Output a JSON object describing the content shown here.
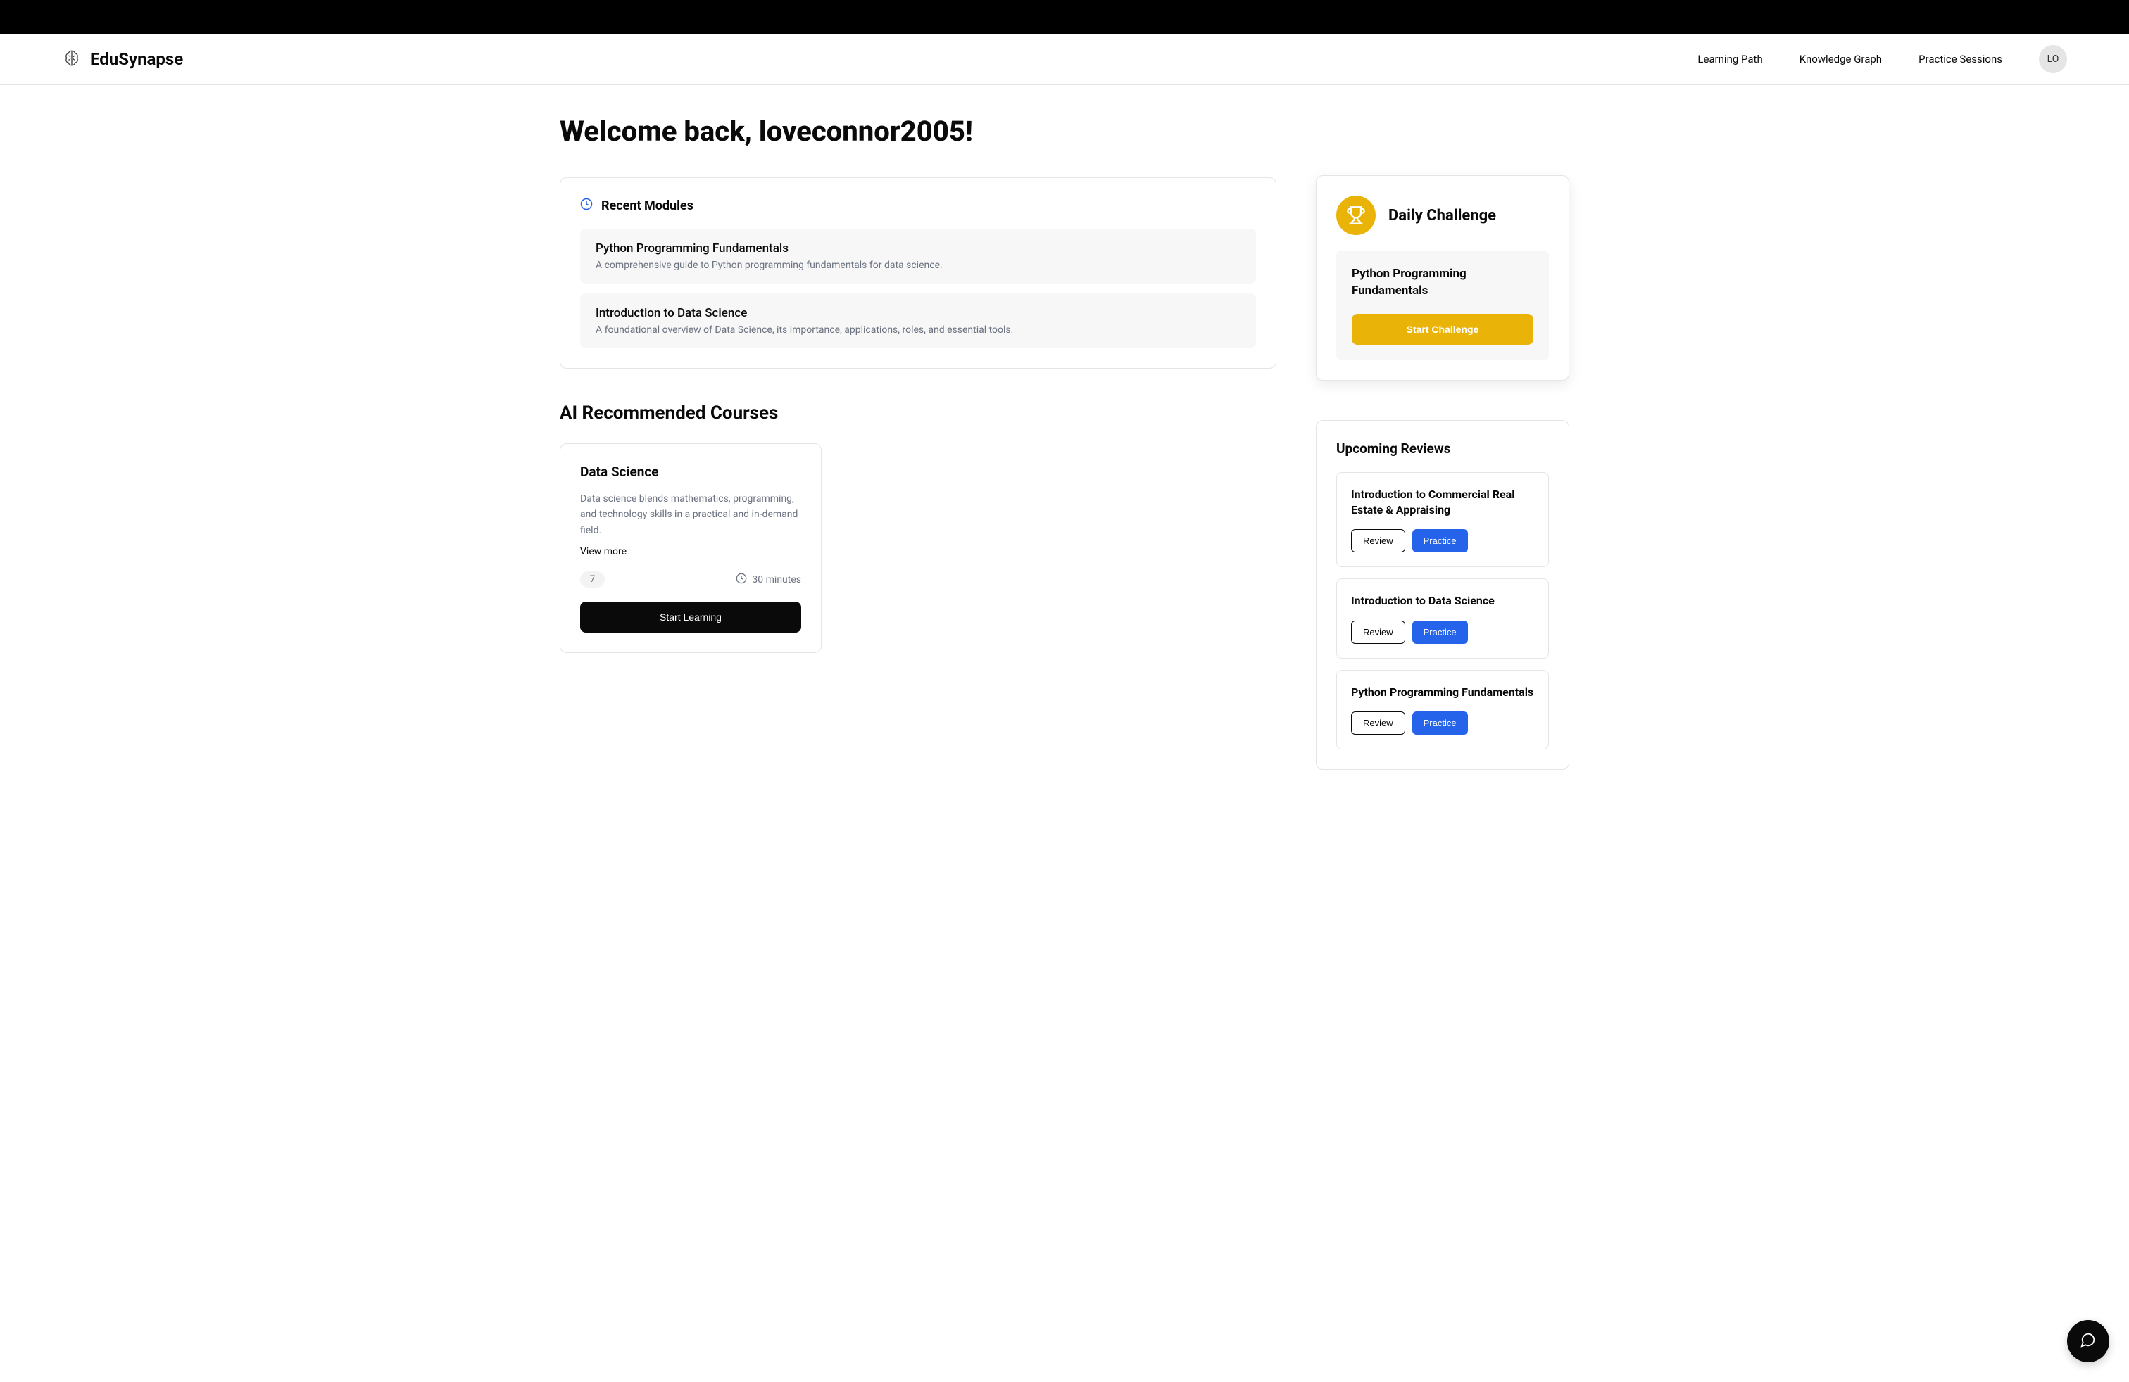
{
  "brand": {
    "name": "EduSynapse"
  },
  "nav": {
    "links": [
      {
        "label": "Learning Path"
      },
      {
        "label": "Knowledge Graph"
      },
      {
        "label": "Practice Sessions"
      }
    ],
    "avatar_initials": "LO"
  },
  "welcome": {
    "heading": "Welcome back, loveconnor2005!"
  },
  "recent_modules": {
    "title": "Recent Modules",
    "items": [
      {
        "title": "Python Programming Fundamentals",
        "description": "A comprehensive guide to Python programming fundamentals for data science."
      },
      {
        "title": "Introduction to Data Science",
        "description": "A foundational overview of Data Science, its importance, applications, roles, and essential tools."
      }
    ]
  },
  "recommended": {
    "section_title": "AI Recommended Courses",
    "courses": [
      {
        "title": "Data Science",
        "description": "Data science blends mathematics, programming, and technology skills in a practical and in-demand field.",
        "view_more": "View more",
        "lesson_count": "7",
        "duration": "30 minutes",
        "cta": "Start Learning"
      }
    ]
  },
  "daily_challenge": {
    "title": "Daily Challenge",
    "topic": "Python Programming Fundamentals",
    "cta": "Start Challenge"
  },
  "upcoming_reviews": {
    "title": "Upcoming Reviews",
    "items": [
      {
        "title": "Introduction to Commercial Real Estate & Appraising"
      },
      {
        "title": "Introduction to Data Science"
      },
      {
        "title": "Python Programming Fundamentals"
      }
    ],
    "review_label": "Review",
    "practice_label": "Practice"
  }
}
